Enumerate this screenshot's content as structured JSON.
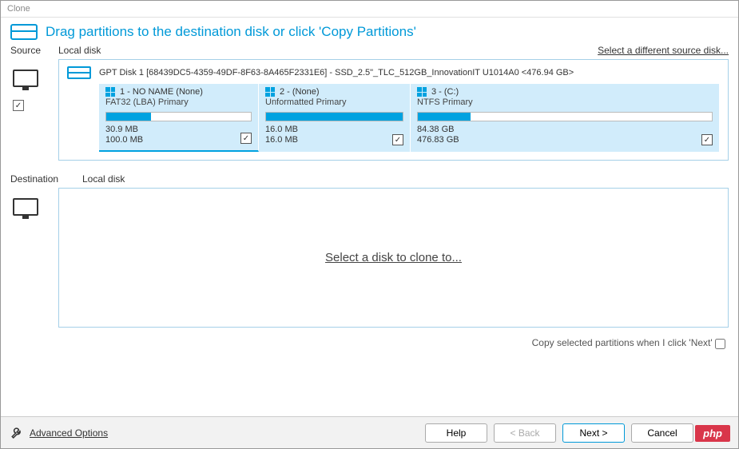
{
  "window": {
    "title": "Clone"
  },
  "header": {
    "title": "Drag partitions to the destination disk or click 'Copy Partitions'"
  },
  "source": {
    "section_label": "Source",
    "disk_type": "Local disk",
    "change_link": "Select a different source disk...",
    "disk_label": "GPT Disk 1 [68439DC5-4359-49DF-8F63-8A465F2331E6] - SSD_2.5\"_TLC_512GB_InnovationIT U1014A0  <476.94 GB>",
    "select_all_checked": "✓",
    "partitions": [
      {
        "title": "1 - NO NAME (None)",
        "subtitle": "FAT32 (LBA) Primary",
        "used": "30.9 MB",
        "total": "100.0 MB",
        "fill_pct": 31,
        "checked": "✓"
      },
      {
        "title": "2 -   (None)",
        "subtitle": "Unformatted Primary",
        "used": "16.0 MB",
        "total": "16.0 MB",
        "fill_pct": 100,
        "checked": "✓"
      },
      {
        "title": "3 -   (C:)",
        "subtitle": "NTFS Primary",
        "used": "84.38 GB",
        "total": "476.83 GB",
        "fill_pct": 18,
        "checked": "✓"
      }
    ]
  },
  "destination": {
    "section_label": "Destination",
    "disk_type": "Local disk",
    "placeholder": "Select a disk to clone to..."
  },
  "copy_option": {
    "label": "Copy selected partitions when I click 'Next'"
  },
  "footer": {
    "advanced": "Advanced Options",
    "help": "Help",
    "back": "< Back",
    "next": "Next >",
    "cancel": "Cancel"
  },
  "badge": {
    "text": "php"
  }
}
